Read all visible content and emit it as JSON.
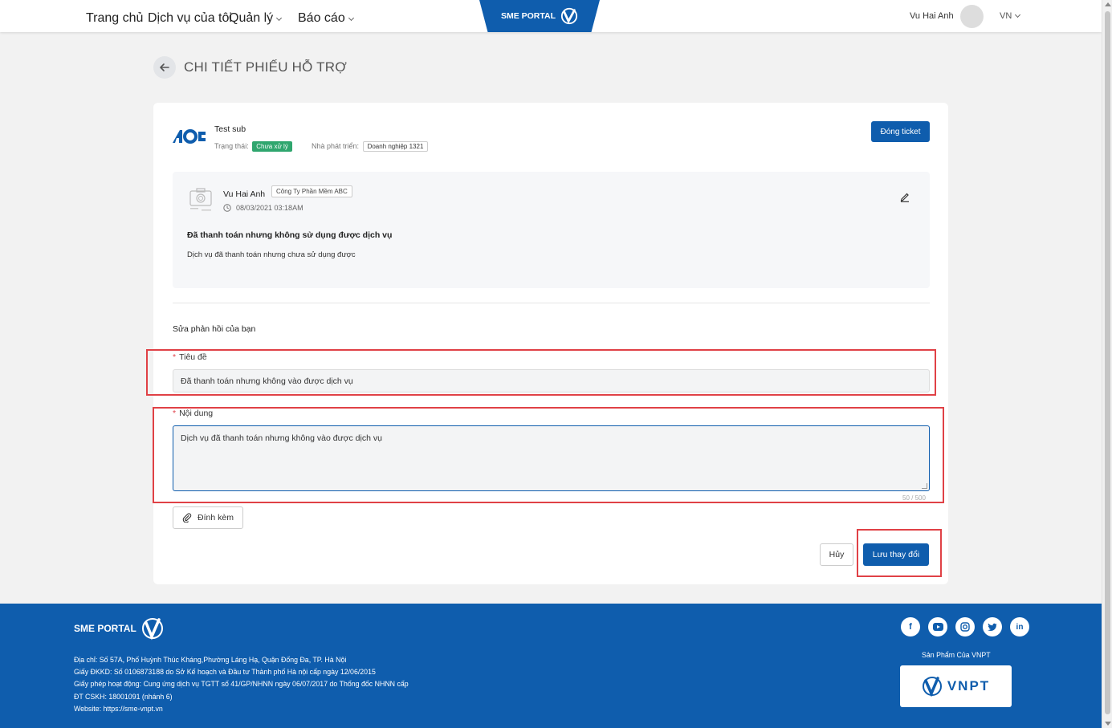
{
  "header": {
    "nav": [
      {
        "label": "Trang chủ",
        "has_dropdown": false
      },
      {
        "label": "Dịch vụ của tôi",
        "has_dropdown": false
      },
      {
        "label": "Quản lý",
        "has_dropdown": true
      },
      {
        "label": "Báo cáo",
        "has_dropdown": true
      }
    ],
    "brand": "SME PORTAL",
    "user_name": "Vu Hai Anh",
    "language": "VN"
  },
  "page": {
    "title": "CHI TIẾT PHIẾU HỖ TRỢ"
  },
  "ticket": {
    "service_name": "Test sub",
    "status_label": "Trạng thái:",
    "status_value": "Chưa xử lý",
    "developer_label": "Nhà phát triển:",
    "developer_value": "Doanh nghiệp 1321",
    "close_button": "Đóng ticket"
  },
  "post": {
    "author": "Vu Hai Anh",
    "company": "Công Ty Phần Mềm ABC",
    "timestamp": "08/03/2021 03:18AM",
    "title": "Đã thanh toán nhưng không sử dụng được dịch vụ",
    "body": "Dịch vụ đã thanh toán nhưng chưa sử dụng được"
  },
  "form": {
    "section_label": "Sửa phản hồi của bạn",
    "title_label": "Tiêu đề",
    "title_value": "Đã thanh toán nhưng không vào được dịch vụ",
    "content_label": "Nội dung",
    "content_value": "Dịch vụ đã thanh toán nhưng không vào được dịch vụ",
    "counter": "50 / 500",
    "attach_button": "Đính kèm",
    "cancel_button": "Hủy",
    "save_button": "Lưu thay đổi"
  },
  "footer": {
    "brand": "SME PORTAL",
    "lines": [
      "Địa chỉ: Số 57A, Phố Huỳnh Thúc Kháng,Phường Láng Hạ, Quận Đống Đa, TP. Hà Nội",
      "Giấy ĐKKD: Số 0106873188 do Sở Kế hoạch và Đầu tư Thành phố Hà nội cấp ngày 12/06/2015",
      "Giấy phép hoạt động: Cung ứng dịch vụ TGTT số 41/GP/NHNN ngày 06/07/2017 do Thống đốc NHNN cấp",
      "ĐT CSKH: 18001091 (nhánh 6)",
      "Website: https://sme-vnpt.vn"
    ],
    "socials": [
      "facebook-icon",
      "youtube-icon",
      "instagram-icon",
      "twitter-icon",
      "linkedin-icon"
    ],
    "product_label": "Sản Phẩm Của VNPT",
    "vnpt_logo_text": "VNPT"
  },
  "colors": {
    "primary": "#0f5dad",
    "status_green": "#2fa66e",
    "highlight_red": "#e04146",
    "required_red": "#e0434b"
  }
}
